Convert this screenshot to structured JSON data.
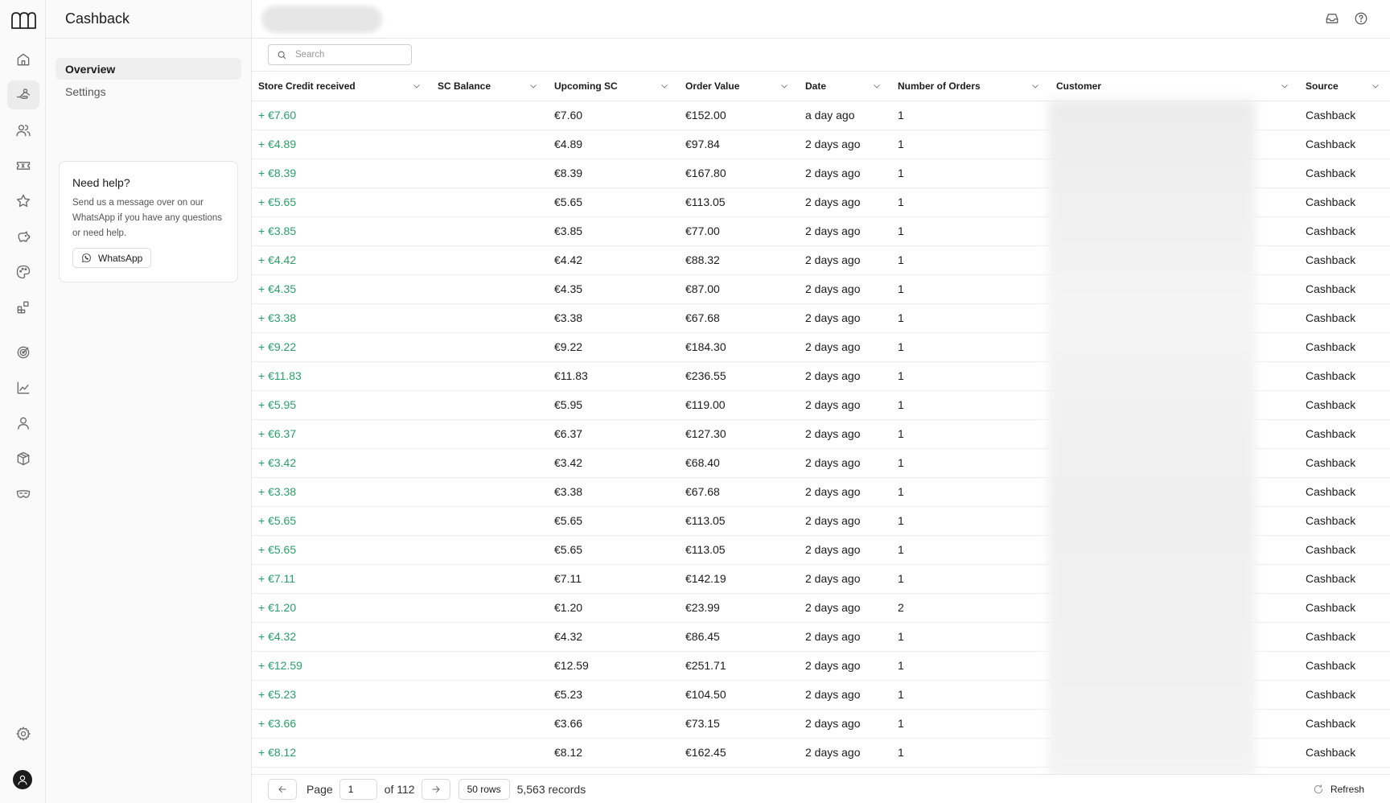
{
  "app": {
    "title": "Cashback"
  },
  "sidebar": {
    "items": [
      {
        "label": "Overview",
        "active": true
      },
      {
        "label": "Settings",
        "active": false
      }
    ],
    "help": {
      "title": "Need help?",
      "text": "Send us a message over on our WhatsApp if you have any questions or need help.",
      "button": "WhatsApp"
    }
  },
  "rail": {
    "icons": [
      "home-icon",
      "cashback-icon",
      "users-icon",
      "ticket-icon",
      "star-icon",
      "piggy-bank-icon",
      "palette-icon",
      "widgets-icon",
      "target-icon",
      "chart-icon",
      "user-icon",
      "box-icon",
      "mask-icon",
      "gear-icon",
      "avatar-icon"
    ]
  },
  "search": {
    "placeholder": "Search"
  },
  "table": {
    "columns": [
      "Store Credit received",
      "SC Balance",
      "Upcoming SC",
      "Order Value",
      "Date",
      "Number of Orders",
      "Customer",
      "Source"
    ],
    "rows": [
      [
        "+ €7.60",
        "",
        "€7.60",
        "€152.00",
        "a day ago",
        "1",
        "",
        "Cashback"
      ],
      [
        "+ €4.89",
        "",
        "€4.89",
        "€97.84",
        "2 days ago",
        "1",
        "",
        "Cashback"
      ],
      [
        "+ €8.39",
        "",
        "€8.39",
        "€167.80",
        "2 days ago",
        "1",
        "",
        "Cashback"
      ],
      [
        "+ €5.65",
        "",
        "€5.65",
        "€113.05",
        "2 days ago",
        "1",
        "",
        "Cashback"
      ],
      [
        "+ €3.85",
        "",
        "€3.85",
        "€77.00",
        "2 days ago",
        "1",
        "",
        "Cashback"
      ],
      [
        "+ €4.42",
        "",
        "€4.42",
        "€88.32",
        "2 days ago",
        "1",
        "",
        "Cashback"
      ],
      [
        "+ €4.35",
        "",
        "€4.35",
        "€87.00",
        "2 days ago",
        "1",
        "",
        "Cashback"
      ],
      [
        "+ €3.38",
        "",
        "€3.38",
        "€67.68",
        "2 days ago",
        "1",
        "",
        "Cashback"
      ],
      [
        "+ €9.22",
        "",
        "€9.22",
        "€184.30",
        "2 days ago",
        "1",
        "",
        "Cashback"
      ],
      [
        "+ €11.83",
        "",
        "€11.83",
        "€236.55",
        "2 days ago",
        "1",
        "",
        "Cashback"
      ],
      [
        "+ €5.95",
        "",
        "€5.95",
        "€119.00",
        "2 days ago",
        "1",
        "",
        "Cashback"
      ],
      [
        "+ €6.37",
        "",
        "€6.37",
        "€127.30",
        "2 days ago",
        "1",
        "",
        "Cashback"
      ],
      [
        "+ €3.42",
        "",
        "€3.42",
        "€68.40",
        "2 days ago",
        "1",
        "",
        "Cashback"
      ],
      [
        "+ €3.38",
        "",
        "€3.38",
        "€67.68",
        "2 days ago",
        "1",
        "",
        "Cashback"
      ],
      [
        "+ €5.65",
        "",
        "€5.65",
        "€113.05",
        "2 days ago",
        "1",
        "",
        "Cashback"
      ],
      [
        "+ €5.65",
        "",
        "€5.65",
        "€113.05",
        "2 days ago",
        "1",
        "",
        "Cashback"
      ],
      [
        "+ €7.11",
        "",
        "€7.11",
        "€142.19",
        "2 days ago",
        "1",
        "",
        "Cashback"
      ],
      [
        "+ €1.20",
        "",
        "€1.20",
        "€23.99",
        "2 days ago",
        "2",
        "",
        "Cashback"
      ],
      [
        "+ €4.32",
        "",
        "€4.32",
        "€86.45",
        "2 days ago",
        "1",
        "",
        "Cashback"
      ],
      [
        "+ €12.59",
        "",
        "€12.59",
        "€251.71",
        "2 days ago",
        "1",
        "",
        "Cashback"
      ],
      [
        "+ €5.23",
        "",
        "€5.23",
        "€104.50",
        "2 days ago",
        "1",
        "",
        "Cashback"
      ],
      [
        "+ €3.66",
        "",
        "€3.66",
        "€73.15",
        "2 days ago",
        "1",
        "",
        "Cashback"
      ],
      [
        "+ €8.12",
        "",
        "€8.12",
        "€162.45",
        "2 days ago",
        "1",
        "",
        "Cashback"
      ]
    ]
  },
  "pagination": {
    "page_label": "Page",
    "page_value": "1",
    "of_label": "of 112",
    "rows_label": "50 rows",
    "records": "5,563 records",
    "refresh": "Refresh"
  },
  "colors": {
    "accent_green": "#2a9d6a"
  }
}
